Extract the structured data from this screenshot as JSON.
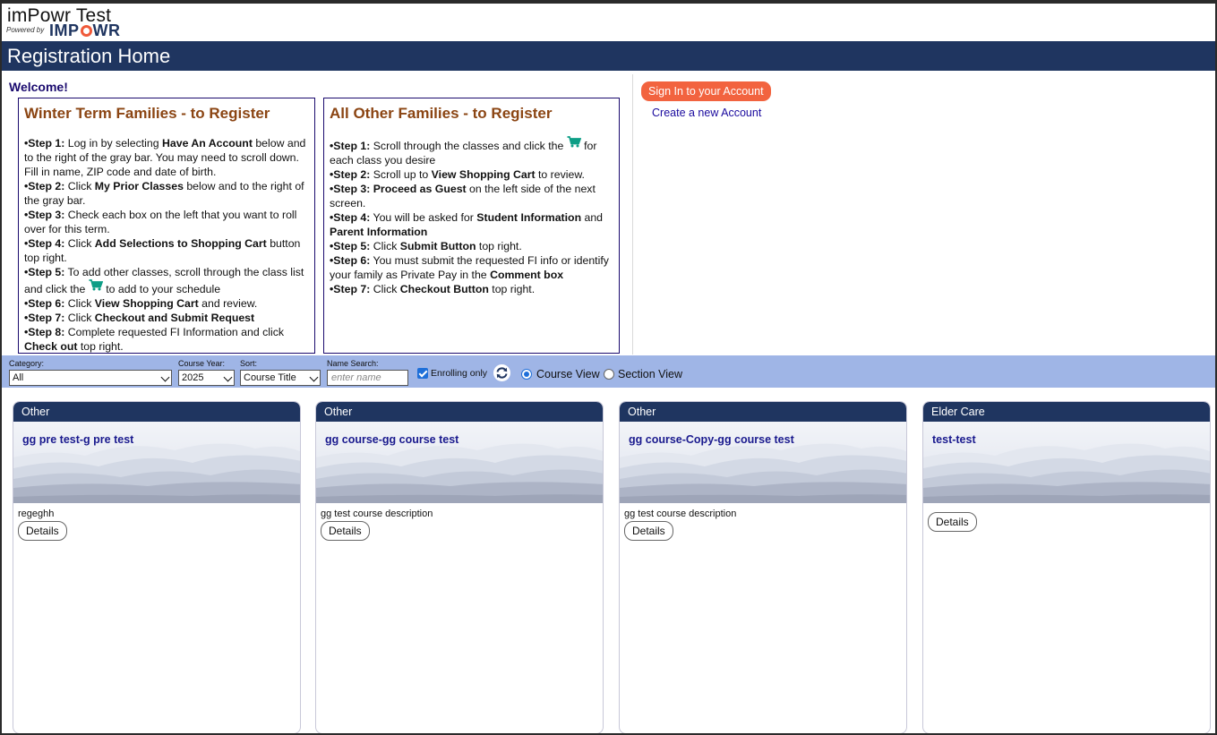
{
  "header": {
    "app_title": "imPowr Test",
    "powered_by": "Powered by",
    "logo_text_a": "IMP",
    "logo_text_b": "WR",
    "page_title": "Registration Home"
  },
  "welcome": "Welcome!",
  "winter_box": {
    "title": "Winter Term Families - to Register",
    "steps": [
      {
        "label": "•Step 1:",
        "parts": [
          " Log in by selecting ",
          {
            "b": "Have An Account"
          },
          " below and to the right of the gray bar. You may need to scroll down. Fill in name, ZIP code and date of birth."
        ]
      },
      {
        "label": "•Step 2:",
        "parts": [
          " Click ",
          {
            "b": "My Prior Classes"
          },
          " below and to the right of the gray bar."
        ]
      },
      {
        "label": "•Step 3:",
        "parts": [
          " Check each box on the left that you want to roll over for this term."
        ]
      },
      {
        "label": "•Step 4:",
        "parts": [
          " Click ",
          {
            "b": "Add Selections to Shopping Cart"
          },
          " button top right."
        ]
      },
      {
        "label": "•Step 5:",
        "parts": [
          " To add other classes, scroll through the class list and click the ",
          {
            "cart": true
          },
          " to add to your schedule"
        ]
      },
      {
        "label": "•Step 6:",
        "parts": [
          " Click ",
          {
            "b": "View Shopping Cart"
          },
          " and review."
        ]
      },
      {
        "label": "•Step 7:",
        "parts": [
          " Click ",
          {
            "b": "Checkout and Submit Request"
          }
        ]
      },
      {
        "label": "•Step 8:",
        "parts": [
          " Complete requested FI Information and click ",
          {
            "b": "Check out"
          },
          " top right."
        ]
      }
    ]
  },
  "other_box": {
    "title": "All Other Families - to Register",
    "steps": [
      {
        "label": "•Step 1:",
        "parts": [
          " Scroll through the classes and click the ",
          {
            "cart": true
          },
          " for each class you desire"
        ]
      },
      {
        "label": "•Step 2:",
        "parts": [
          " Scroll up to ",
          {
            "b": "View Shopping Cart"
          },
          " to review."
        ]
      },
      {
        "label": "•Step 3:",
        "parts": [
          " ",
          {
            "b": "Proceed as Guest"
          },
          " on the left side of the next screen."
        ]
      },
      {
        "label": "•Step 4:",
        "parts": [
          " You will be asked for ",
          {
            "b": "Student Information"
          },
          " and ",
          {
            "b": "Parent Information"
          }
        ]
      },
      {
        "label": "•Step 5:",
        "parts": [
          " Click ",
          {
            "b": "Submit Button"
          },
          " top right."
        ]
      },
      {
        "label": "•Step 6:",
        "parts": [
          " You must submit the requested FI info or identify your family as Private Pay in the ",
          {
            "b": "Comment box"
          }
        ]
      },
      {
        "label": "•Step 7:",
        "parts": [
          " Click ",
          {
            "b": "Checkout Button"
          },
          " top right."
        ]
      }
    ]
  },
  "account": {
    "sign_in": "Sign In to your Account",
    "create": "Create a new Account"
  },
  "filters": {
    "category_label": "Category:",
    "category_value": "All",
    "year_label": "Course Year:",
    "year_value": "2025",
    "sort_label": "Sort:",
    "sort_value": "Course Title",
    "search_label": "Name Search:",
    "search_placeholder": "enter name",
    "enrolling_label": "Enrolling only",
    "enrolling_checked": true,
    "course_view_label": "Course View",
    "section_view_label": "Section View",
    "selected_view": "Course View"
  },
  "cards": [
    {
      "category": "Other",
      "title": "gg pre test-g pre test",
      "description": "regeghh",
      "details": "Details"
    },
    {
      "category": "Other",
      "title": "gg course-gg course test",
      "description": "gg test course description",
      "details": "Details"
    },
    {
      "category": "Other",
      "title": "gg course-Copy-gg course test",
      "description": "gg test course description",
      "details": "Details"
    },
    {
      "category": "Elder Care",
      "title": "test-test",
      "description": "",
      "details": "Details"
    }
  ],
  "colors": {
    "navy": "#1f3560",
    "accent_orange": "#f2633f",
    "step_title_brown": "#8b4513",
    "filter_bar": "#9fb5e6",
    "cart_green": "#0d9e86"
  }
}
